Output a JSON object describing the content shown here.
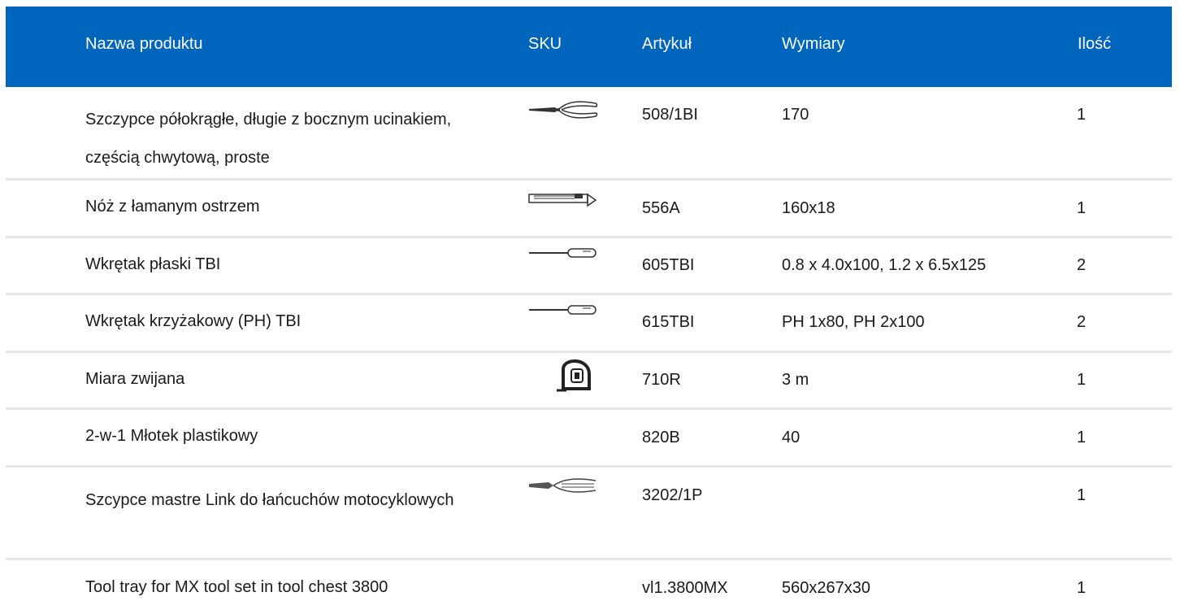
{
  "headers": {
    "name": "Nazwa produktu",
    "sku": "SKU",
    "article": "Artykuł",
    "dimensions": "Wymiary",
    "qty": "Ilość"
  },
  "rows": [
    {
      "name": "Szczypce półokrągłe, długie z bocznym ucinakiem, częścią chwytową, proste",
      "icon": "long-nose-pliers-icon",
      "article": "508/1BI",
      "dimensions": "170",
      "qty": "1"
    },
    {
      "name": "Nóż z łamanym ostrzem",
      "icon": "snap-off-knife-icon",
      "article": "556A",
      "dimensions": "160x18",
      "qty": "1"
    },
    {
      "name": "Wkrętak płaski TBI",
      "icon": "flat-screwdriver-icon",
      "article": "605TBI",
      "dimensions": "0.8 x 4.0x100, 1.2 x 6.5x125",
      "qty": "2"
    },
    {
      "name": "Wkrętak krzyżakowy (PH) TBI",
      "icon": "phillips-screwdriver-icon",
      "article": "615TBI",
      "dimensions": "PH 1x80, PH 2x100",
      "qty": "2"
    },
    {
      "name": "Miara zwijana",
      "icon": "tape-measure-icon",
      "article": "710R",
      "dimensions": "3 m",
      "qty": "1"
    },
    {
      "name": "2-w-1 Młotek plastikowy",
      "icon": "",
      "article": "820B",
      "dimensions": "40",
      "qty": "1"
    },
    {
      "name": "Szcypce mastre Link do łańcuchów motocyklowych",
      "icon": "chain-pliers-icon",
      "article": "3202/1P",
      "dimensions": "",
      "qty": "1"
    },
    {
      "name": "Tool tray for MX tool set in tool chest 3800",
      "icon": "",
      "article": "vl1.3800MX",
      "dimensions": "560x267x30",
      "qty": "1"
    }
  ]
}
